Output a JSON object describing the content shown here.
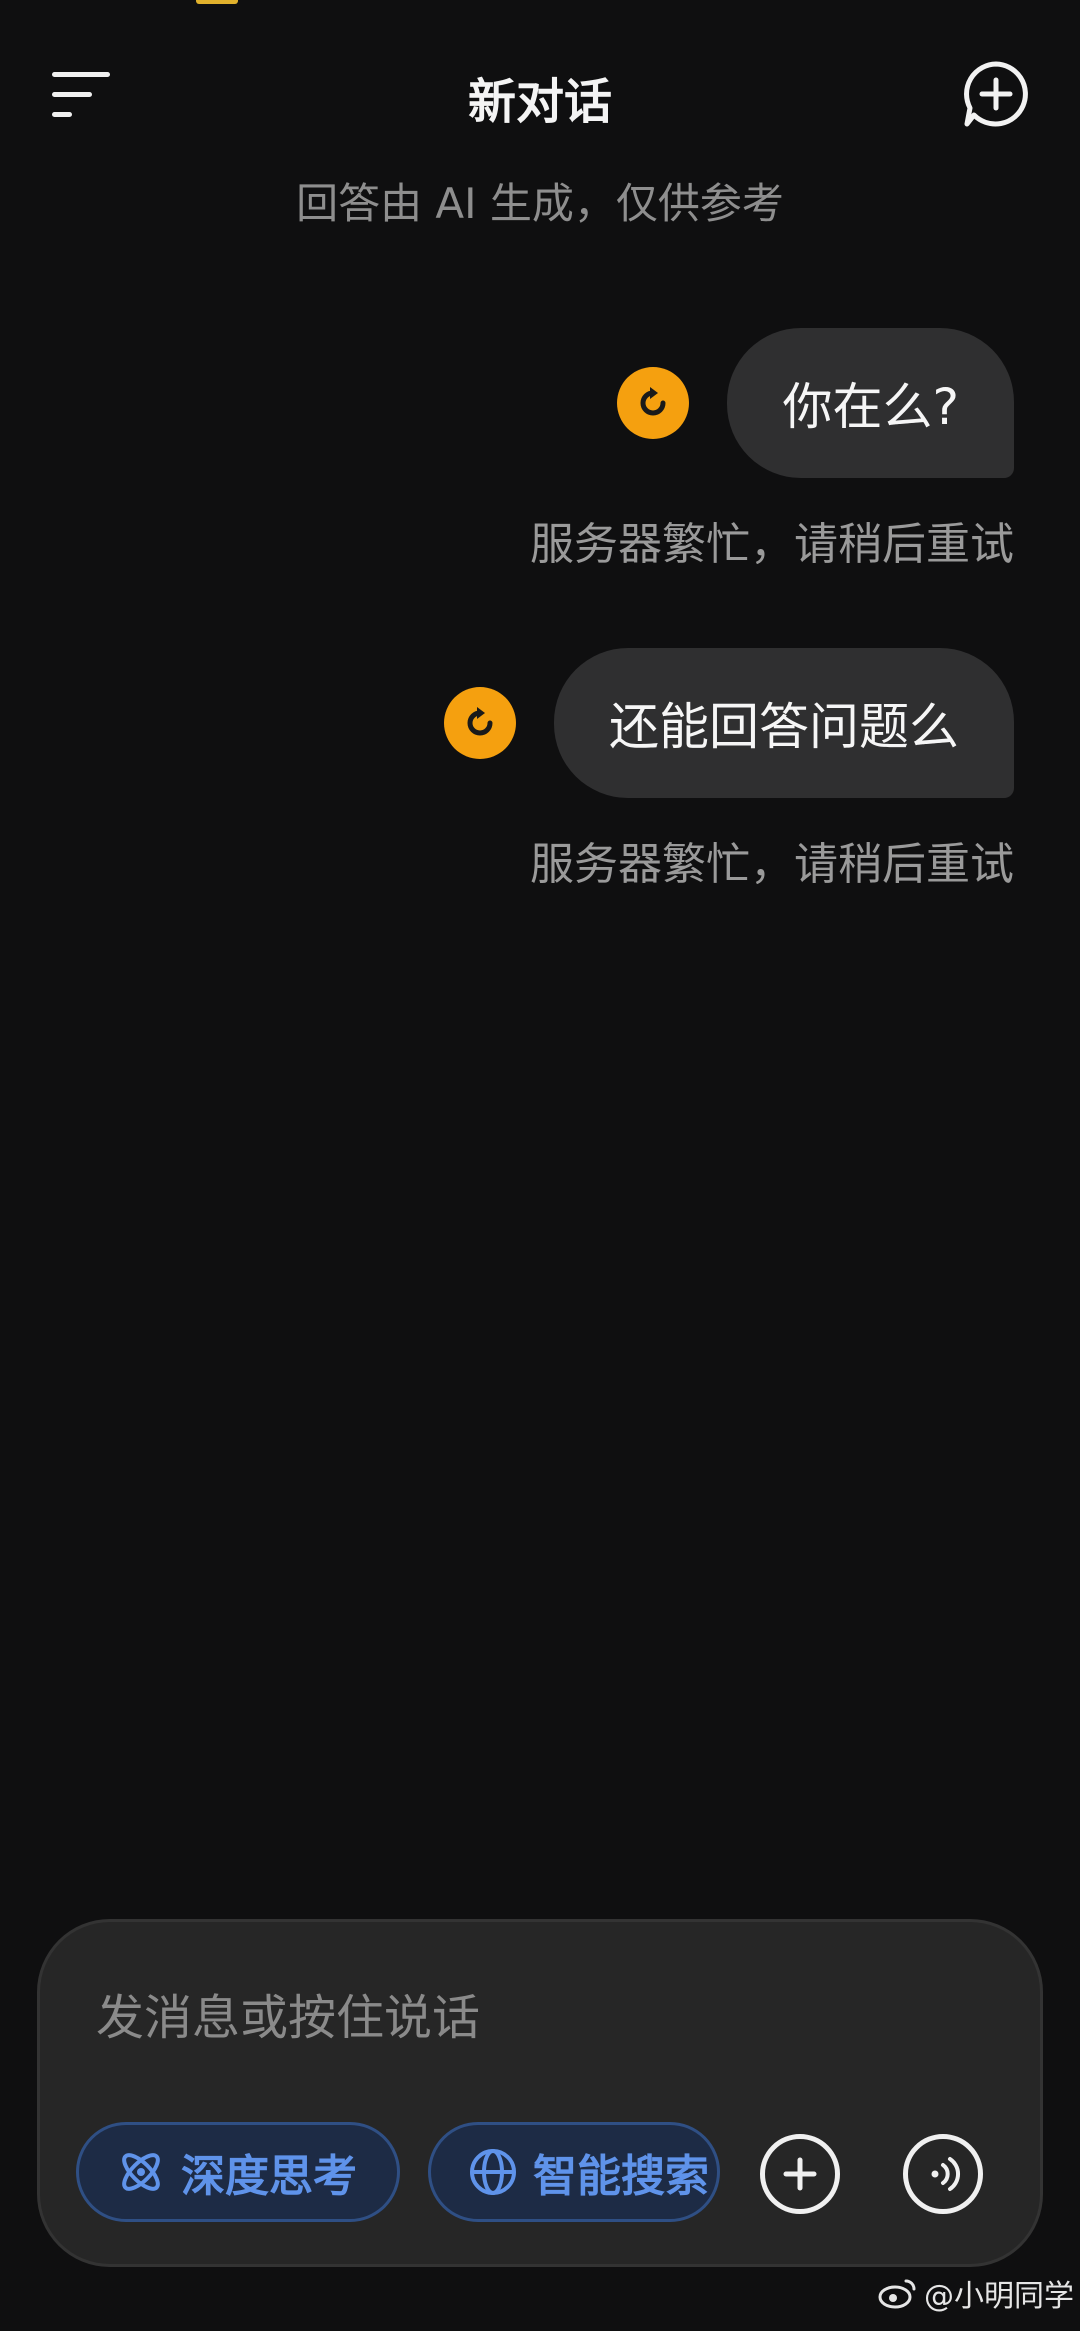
{
  "header": {
    "title": "新对话",
    "menu_icon": "menu-icon",
    "new_chat_icon": "new-chat-icon"
  },
  "disclaimer": "回答由 AI 生成，仅供参考",
  "messages": [
    {
      "user_text": "你在么?",
      "status_text": "服务器繁忙，请稍后重试"
    },
    {
      "user_text": "还能回答问题么",
      "status_text": "服务器繁忙，请稍后重试"
    }
  ],
  "input": {
    "placeholder": "发消息或按住说话",
    "deep_think_label": "深度思考",
    "smart_search_label": "智能搜索"
  },
  "watermark": "@小明同学",
  "colors": {
    "background": "#0f0f10",
    "bubble": "#2f2f30",
    "retry_icon": "#f5a00f",
    "chip_text": "#5f93ea"
  }
}
